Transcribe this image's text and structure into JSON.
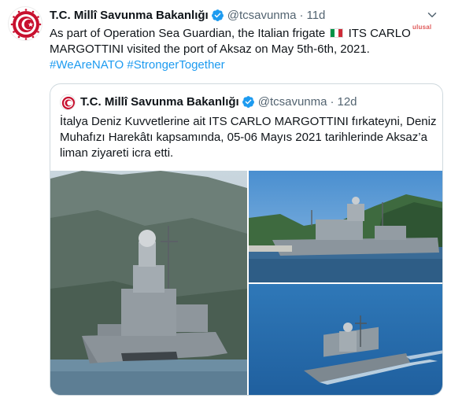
{
  "tweet": {
    "author_name": "T.C. Millî Savunma Bakanlığı",
    "handle": "@tcsavunma",
    "separator": "·",
    "time": "11d",
    "text_line1_a": "As part of Operation Sea Guardian, the Italian frigate",
    "text_line1_b": "ITS CARLO",
    "text_line2": "MARGOTTINI visited the port of Aksaz on May 5th-6th, 2021.",
    "hashtag1": "#WeAreNATO",
    "hashtag2": "#StrongerTogether",
    "flag_icon": "italy-flag-icon",
    "watermark": "ulusal"
  },
  "quoted": {
    "author_name": "T.C. Millî Savunma Bakanlığı",
    "handle": "@tcsavunma",
    "separator": "·",
    "time": "12d",
    "text_line1": "İtalya Deniz Kuvvetlerine ait ITS CARLO MARGOTTINI fırkateyni, Deniz",
    "text_line2": "Muhafızı Harekâtı kapsamında, 05-06 Mayıs 2021 tarihlerinde Aksaz’a",
    "text_line3": "liman ziyareti icra etti."
  },
  "colors": {
    "link": "#1d9bf0",
    "muted": "#536471",
    "verified": "#1d9bf0",
    "emblem_red": "#c8102e"
  }
}
